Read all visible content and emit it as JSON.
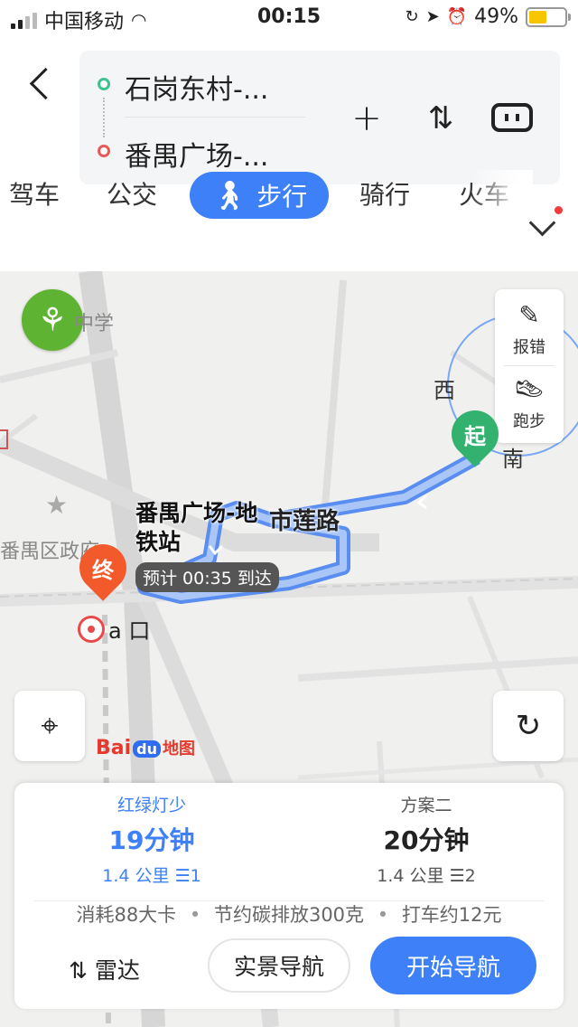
{
  "status_bar": {
    "carrier": "中国移动",
    "time": "00:15",
    "battery": "49%",
    "battery_level": 0.49
  },
  "route": {
    "start": "石岗东村-...",
    "end": "番禺广场-..."
  },
  "tabs": [
    {
      "label": "驾车"
    },
    {
      "label": "公交"
    },
    {
      "label": "步行",
      "active": true
    },
    {
      "label": "骑行"
    },
    {
      "label": "火车"
    }
  ],
  "map": {
    "school_label": "中学",
    "gov_label": "番禺区政府",
    "side_panel": {
      "report": "报错",
      "run": "跑步"
    },
    "destination_name": "番禺广场-地铁站",
    "eta": "预计 00:35 到达",
    "road_name": "市莲路",
    "start_pin": "起",
    "end_pin": "终",
    "exit_label": "a 口",
    "logo": {
      "bai": "Bai",
      "du": "du",
      "map": "地图"
    },
    "edge_labels": {
      "west": "西",
      "label2": "南"
    }
  },
  "plans": [
    {
      "tag": "红绿灯少",
      "time": "19分钟",
      "distance": "1.4 公里",
      "lights": "1"
    },
    {
      "tag": "方案二",
      "time": "20分钟",
      "distance": "1.4 公里",
      "lights": "2"
    }
  ],
  "stats": {
    "calories": "消耗88大卡",
    "carbon": "节约碳排放300克",
    "taxi": "打车约12元"
  },
  "actions": {
    "radar": "雷达",
    "ar_nav": "实景导航",
    "start_nav": "开始导航"
  },
  "colors": {
    "accent": "#3d80f7",
    "start_green": "#33b26f",
    "end_orange": "#f25a2c"
  }
}
